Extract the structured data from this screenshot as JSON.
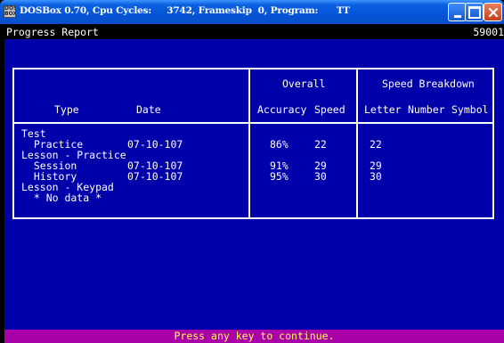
{
  "window": {
    "title": "DOSBox 0.70, Cpu Cycles:     3742, Frameskip  0, Program:      TT",
    "icon_label": "DOS BOX",
    "controls": [
      "minimize-icon",
      "maximize-icon",
      "close-icon"
    ]
  },
  "report": {
    "title": "Progress Report",
    "code": "59001"
  },
  "table": {
    "group_headers": {
      "overall": "Overall",
      "speed_breakdown": "Speed Breakdown"
    },
    "columns": {
      "type": "Type",
      "date": "Date",
      "accuracy": "Accuracy",
      "speed": "Speed",
      "letter": "Letter",
      "number": "Number",
      "symbol": "Symbol"
    },
    "rows": [
      {
        "type": "Test",
        "date": "",
        "accuracy": "",
        "speed": "",
        "letter": ""
      },
      {
        "type": "  Practice",
        "date": "07-10-107",
        "accuracy": "86%",
        "speed": "22",
        "letter": "22"
      },
      {
        "type": "Lesson - Practice",
        "date": "",
        "accuracy": "",
        "speed": "",
        "letter": ""
      },
      {
        "type": "  Session",
        "date": "07-10-107",
        "accuracy": "91%",
        "speed": "29",
        "letter": "29"
      },
      {
        "type": "  History",
        "date": "07-10-107",
        "accuracy": "95%",
        "speed": "30",
        "letter": "30"
      },
      {
        "type": "Lesson - Keypad",
        "date": "",
        "accuracy": "",
        "speed": "",
        "letter": ""
      },
      {
        "type": "  * No data *",
        "date": "",
        "accuracy": "",
        "speed": "",
        "letter": ""
      }
    ]
  },
  "footer": {
    "prompt": "Press any key to continue."
  },
  "colors": {
    "screen_bg": "#0000aa",
    "footer_bg": "#aa00aa",
    "footer_text": "#ffff55",
    "titlebar": "#0654d8"
  }
}
